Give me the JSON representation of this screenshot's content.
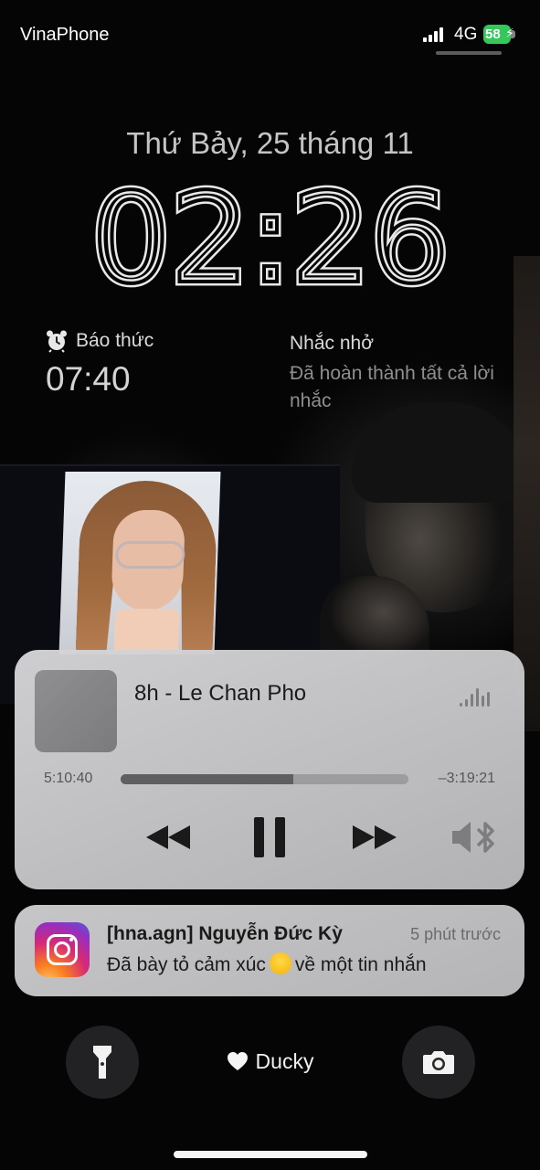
{
  "status_bar": {
    "carrier": "VinaPhone",
    "network": "4G",
    "battery": "58"
  },
  "lock_screen": {
    "date": "Thứ Bảy, 25 tháng 11",
    "time": "02:26"
  },
  "widgets": {
    "alarm": {
      "label": "Báo thức",
      "time": "07:40",
      "icon": "alarm-clock-icon"
    },
    "reminders": {
      "title": "Nhắc nhở",
      "text": "Đã hoàn thành tất cả lời nhắc"
    }
  },
  "media_player": {
    "song_title": "8h - Le Chan Pho",
    "elapsed": "5:10:40",
    "remaining": "–3:19:21",
    "progress": 0.6
  },
  "notification": {
    "app_icon": "instagram-icon",
    "title": "[hna.agn] Nguyễn Đức Kỳ",
    "time": "5 phút trước",
    "body_before": "Đã bày tỏ cảm xúc",
    "body_after": "về một tin nhắn"
  },
  "bottom": {
    "focus_label": "Ducky"
  },
  "colors": {
    "battery": "#34c759",
    "player_bg": "#cfcfd1"
  }
}
